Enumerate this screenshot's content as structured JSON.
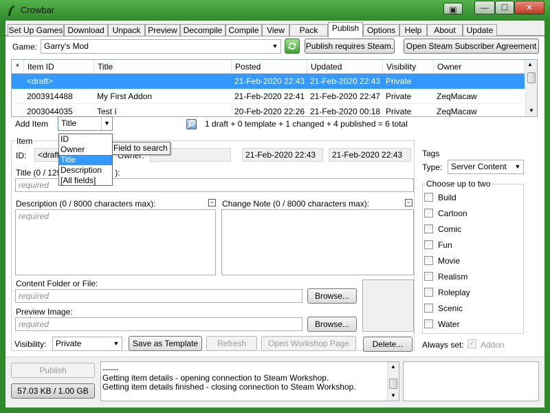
{
  "window": {
    "title": "Crowbar",
    "minimize": "—",
    "maximize": "☐",
    "close": "✕",
    "restore_small": "▣"
  },
  "tabs": [
    "Set Up Games",
    "Download",
    "Unpack",
    "Preview",
    "Decompile",
    "Compile",
    "View",
    "Pack",
    "Publish",
    "Options",
    "Help",
    "About",
    "Update"
  ],
  "active_tab": "Publish",
  "game_row": {
    "label": "Game:",
    "value": "Garry's Mod",
    "refresh_icon": "refresh-icon",
    "requires_button": "Publish requires Steam.",
    "agreement_button": "Open Steam Subscriber Agreement"
  },
  "list": {
    "headers": [
      "*",
      "Item ID",
      "Title",
      "Posted",
      "Updated",
      "Visibility",
      "Owner"
    ],
    "rows": [
      {
        "star": "",
        "id": "<draft>",
        "title": "",
        "posted": "21-Feb-2020 22:43",
        "updated": "21-Feb-2020 22:43",
        "visibility": "Private",
        "owner": ""
      },
      {
        "star": "",
        "id": "2003914488",
        "title": "My First Addon",
        "posted": "21-Feb-2020 22:41",
        "updated": "21-Feb-2020 22:47",
        "visibility": "Private",
        "owner": "ZeqMacaw"
      },
      {
        "star": "",
        "id": "2003044035",
        "title": "Test í",
        "posted": "20-Feb-2020 22:26",
        "updated": "21-Feb-2020 00:18",
        "visibility": "Private",
        "owner": "ZeqMacaw"
      }
    ]
  },
  "search_bar": {
    "add_item": "Add Item",
    "field_combo": "Title",
    "search_icon": "search-icon",
    "summary": "1 draft + 0 template + 1 changed + 4 published = 6 total"
  },
  "field_popup": {
    "options": [
      "ID",
      "Owner",
      "Title",
      "Description",
      "[All fields]"
    ],
    "selected": "Title",
    "tooltip": "Field to search"
  },
  "item": {
    "group_label": "Item",
    "id_label": "ID:",
    "id_value": "<draft>",
    "owner_label": "Owner:",
    "posted": "21-Feb-2020 22:43",
    "updated": "21-Feb-2020 22:43",
    "title_label": "Title (0 / 129",
    "title_label_tail": "):",
    "title_placeholder": "required",
    "description_label": "Description (0 / 8000 characters max):",
    "description_placeholder": "required",
    "change_note_label": "Change Note (0 / 8000 characters max):",
    "content_label": "Content Folder or File:",
    "content_placeholder": "required",
    "browse_label": "Browse...",
    "preview_label": "Preview Image:",
    "preview_placeholder": "required",
    "visibility_label": "Visibility:",
    "visibility_value": "Private",
    "save_template": "Save as Template",
    "refresh": "Refresh",
    "open_workshop": "Open Workshop Page",
    "delete": "Delete..."
  },
  "tags": {
    "group_label": "Tags",
    "type_label": "Type:",
    "type_value": "Server Content",
    "choose_label": "Choose up to two",
    "items": [
      "Build",
      "Cartoon",
      "Comic",
      "Fun",
      "Movie",
      "Realism",
      "Roleplay",
      "Scenic",
      "Water"
    ],
    "always_set_label": "Always set:",
    "addon_label": "Addon"
  },
  "bottom": {
    "publish": "Publish",
    "size": "57.03 KB / 1.00 GB",
    "log": [
      "------",
      "Getting item details - opening connection to Steam Workshop.",
      "Getting item details finished - closing connection to Steam Workshop."
    ]
  }
}
